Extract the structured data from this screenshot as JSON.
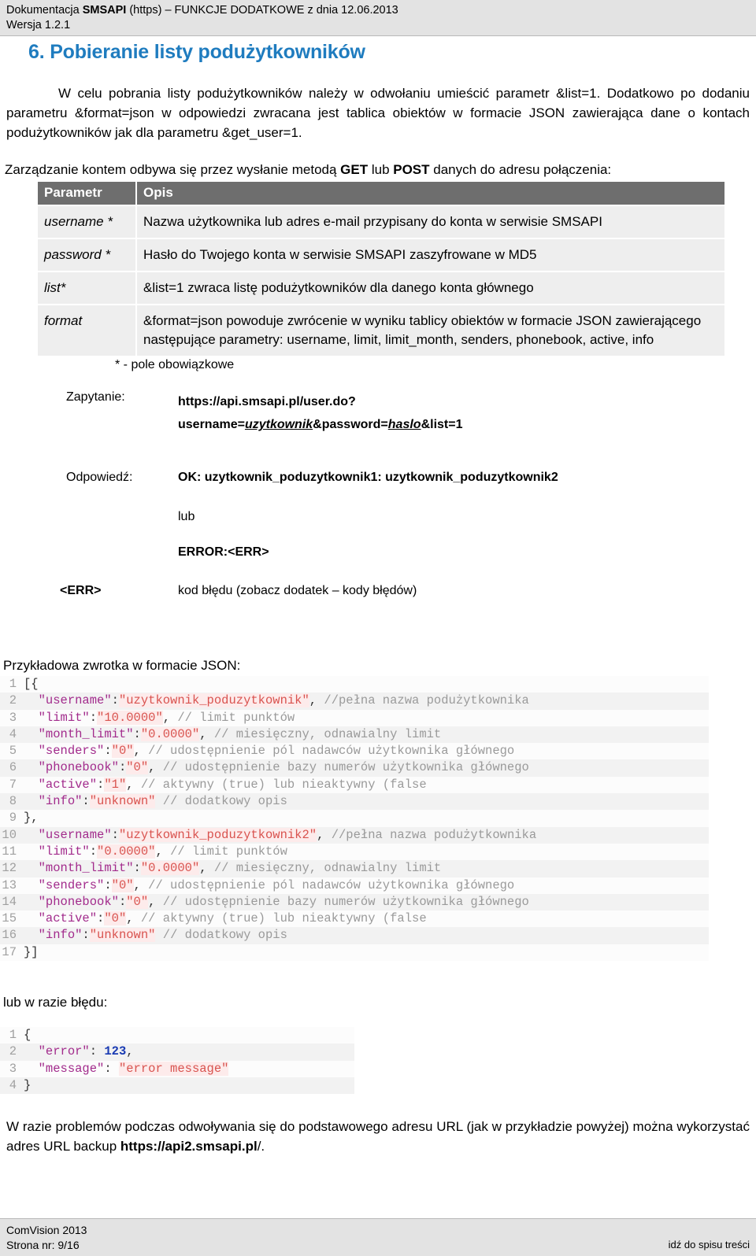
{
  "header": {
    "line1_prefix": "Dokumentacja ",
    "line1_bold": "SMSAPI",
    "line1_suffix": " (https) – FUNKCJE DODATKOWE  z dnia 12.06.2013",
    "line2": "Wersja 1.2.1"
  },
  "section": {
    "title": "6. Pobieranie listy podużytkowników",
    "intro": "W celu pobrania listy podużytkowników należy w odwołaniu umieścić parametr &list=1. Dodatkowo po dodaniu parametru &format=json w odpowiedzi zwracana jest tablica obiektów w formacie JSON zawierająca dane o kontach podużytkowników jak dla parametru &get_user=1."
  },
  "mgmt": {
    "part1": "Zarządzanie kontem odbywa się przez wysłanie metodą ",
    "get": "GET",
    "mid": " lub ",
    "post": "POST",
    "part2": " danych do adresu połączenia:"
  },
  "table": {
    "headers": [
      "Parametr",
      "Opis"
    ],
    "rows": [
      {
        "param": "username *",
        "desc": "Nazwa użytkownika lub adres e-mail przypisany do konta  w serwisie SMSAPI"
      },
      {
        "param": "password *",
        "desc": "Hasło do Twojego konta w serwisie SMSAPI zaszyfrowane w MD5"
      },
      {
        "param": "list*",
        "desc": "&list=1 zwraca listę podużytkowników dla danego konta głównego"
      },
      {
        "param": "format",
        "desc": "&format=json powoduje zwrócenie w wyniku tablicy obiektów w formacie JSON zawierającego następujące parametry: username, limit, limit_month, senders, phonebook, active, info"
      }
    ],
    "required_note": "* - pole obowiązkowe"
  },
  "query": {
    "label": "Zapytanie:",
    "url_line1": "https://api.smsapi.pl/user.do?",
    "url_line2_a": "username=",
    "url_line2_b": "uzytkownik",
    "url_line2_c": "&password=",
    "url_line2_d": "haslo",
    "url_line2_e": "&list=1"
  },
  "response": {
    "label": "Odpowiedź:",
    "ok": "OK: uzytkownik_poduzytkownik1: uzytkownik_poduzytkownik2",
    "or": "lub",
    "error": "ERROR:<ERR>",
    "err_label": "<ERR>",
    "err_desc": "kod błędu (zobacz dodatek – kody błędów)"
  },
  "json_example": {
    "caption": "Przykładowa zwrotka w formacie JSON:",
    "lines": [
      {
        "n": "1",
        "tokens": [
          {
            "t": "pl",
            "v": "[{"
          }
        ]
      },
      {
        "n": "2",
        "tokens": [
          {
            "t": "pl",
            "v": "  "
          },
          {
            "t": "key",
            "v": "\"username\""
          },
          {
            "t": "pl",
            "v": ":"
          },
          {
            "t": "str",
            "v": "\"uzytkownik_poduzytkownik\""
          },
          {
            "t": "pl",
            "v": ", "
          },
          {
            "t": "com",
            "v": "//pełna nazwa podużytkownika"
          }
        ]
      },
      {
        "n": "3",
        "tokens": [
          {
            "t": "pl",
            "v": "  "
          },
          {
            "t": "key",
            "v": "\"limit\""
          },
          {
            "t": "pl",
            "v": ":"
          },
          {
            "t": "str",
            "v": "\"10.0000\""
          },
          {
            "t": "pl",
            "v": ", "
          },
          {
            "t": "com",
            "v": "// limit punktów"
          }
        ]
      },
      {
        "n": "4",
        "tokens": [
          {
            "t": "pl",
            "v": "  "
          },
          {
            "t": "key",
            "v": "\"month_limit\""
          },
          {
            "t": "pl",
            "v": ":"
          },
          {
            "t": "str",
            "v": "\"0.0000\""
          },
          {
            "t": "pl",
            "v": ", "
          },
          {
            "t": "com",
            "v": "// miesięczny, odnawialny limit"
          }
        ]
      },
      {
        "n": "5",
        "tokens": [
          {
            "t": "pl",
            "v": "  "
          },
          {
            "t": "key",
            "v": "\"senders\""
          },
          {
            "t": "pl",
            "v": ":"
          },
          {
            "t": "str",
            "v": "\"0\""
          },
          {
            "t": "pl",
            "v": ", "
          },
          {
            "t": "com",
            "v": "// udostępnienie pól nadawców użytkownika głównego"
          }
        ]
      },
      {
        "n": "6",
        "tokens": [
          {
            "t": "pl",
            "v": "  "
          },
          {
            "t": "key",
            "v": "\"phonebook\""
          },
          {
            "t": "pl",
            "v": ":"
          },
          {
            "t": "str",
            "v": "\"0\""
          },
          {
            "t": "pl",
            "v": ", "
          },
          {
            "t": "com",
            "v": "// udostępnienie bazy numerów użytkownika głównego"
          }
        ]
      },
      {
        "n": "7",
        "tokens": [
          {
            "t": "pl",
            "v": "  "
          },
          {
            "t": "key",
            "v": "\"active\""
          },
          {
            "t": "pl",
            "v": ":"
          },
          {
            "t": "str",
            "v": "\"1\""
          },
          {
            "t": "pl",
            "v": ", "
          },
          {
            "t": "com",
            "v": "// aktywny (true) lub nieaktywny (false"
          }
        ]
      },
      {
        "n": "8",
        "tokens": [
          {
            "t": "pl",
            "v": "  "
          },
          {
            "t": "key",
            "v": "\"info\""
          },
          {
            "t": "pl",
            "v": ":"
          },
          {
            "t": "str",
            "v": "\"unknown\""
          },
          {
            "t": "pl",
            "v": " "
          },
          {
            "t": "com",
            "v": "// dodatkowy opis"
          }
        ]
      },
      {
        "n": "9",
        "tokens": [
          {
            "t": "pl",
            "v": "},"
          }
        ]
      },
      {
        "n": "10",
        "tokens": [
          {
            "t": "pl",
            "v": "  "
          },
          {
            "t": "key",
            "v": "\"username\""
          },
          {
            "t": "pl",
            "v": ":"
          },
          {
            "t": "str",
            "v": "\"uzytkownik_poduzytkownik2\""
          },
          {
            "t": "pl",
            "v": ", "
          },
          {
            "t": "com",
            "v": "//pełna nazwa podużytkownika"
          }
        ]
      },
      {
        "n": "11",
        "tokens": [
          {
            "t": "pl",
            "v": "  "
          },
          {
            "t": "key",
            "v": "\"limit\""
          },
          {
            "t": "pl",
            "v": ":"
          },
          {
            "t": "str",
            "v": "\"0.0000\""
          },
          {
            "t": "pl",
            "v": ", "
          },
          {
            "t": "com",
            "v": "// limit punktów"
          }
        ]
      },
      {
        "n": "12",
        "tokens": [
          {
            "t": "pl",
            "v": "  "
          },
          {
            "t": "key",
            "v": "\"month_limit\""
          },
          {
            "t": "pl",
            "v": ":"
          },
          {
            "t": "str",
            "v": "\"0.0000\""
          },
          {
            "t": "pl",
            "v": ", "
          },
          {
            "t": "com",
            "v": "// miesięczny, odnawialny limit"
          }
        ]
      },
      {
        "n": "13",
        "tokens": [
          {
            "t": "pl",
            "v": "  "
          },
          {
            "t": "key",
            "v": "\"senders\""
          },
          {
            "t": "pl",
            "v": ":"
          },
          {
            "t": "str",
            "v": "\"0\""
          },
          {
            "t": "pl",
            "v": ", "
          },
          {
            "t": "com",
            "v": "// udostępnienie pól nadawców użytkownika głównego"
          }
        ]
      },
      {
        "n": "14",
        "tokens": [
          {
            "t": "pl",
            "v": "  "
          },
          {
            "t": "key",
            "v": "\"phonebook\""
          },
          {
            "t": "pl",
            "v": ":"
          },
          {
            "t": "str",
            "v": "\"0\""
          },
          {
            "t": "pl",
            "v": ", "
          },
          {
            "t": "com",
            "v": "// udostępnienie bazy numerów użytkownika głównego"
          }
        ]
      },
      {
        "n": "15",
        "tokens": [
          {
            "t": "pl",
            "v": "  "
          },
          {
            "t": "key",
            "v": "\"active\""
          },
          {
            "t": "pl",
            "v": ":"
          },
          {
            "t": "str",
            "v": "\"0\""
          },
          {
            "t": "pl",
            "v": ", "
          },
          {
            "t": "com",
            "v": "// aktywny (true) lub nieaktywny (false"
          }
        ]
      },
      {
        "n": "16",
        "tokens": [
          {
            "t": "pl",
            "v": "  "
          },
          {
            "t": "key",
            "v": "\"info\""
          },
          {
            "t": "pl",
            "v": ":"
          },
          {
            "t": "str",
            "v": "\"unknown\""
          },
          {
            "t": "pl",
            "v": " "
          },
          {
            "t": "com",
            "v": "// dodatkowy opis"
          }
        ]
      },
      {
        "n": "17",
        "tokens": [
          {
            "t": "pl",
            "v": "}]"
          }
        ]
      }
    ]
  },
  "error_example": {
    "caption": "lub w razie błędu:",
    "lines": [
      {
        "n": "1",
        "tokens": [
          {
            "t": "pl",
            "v": "{"
          }
        ]
      },
      {
        "n": "2",
        "tokens": [
          {
            "t": "pl",
            "v": "  "
          },
          {
            "t": "key",
            "v": "\"error\""
          },
          {
            "t": "pl",
            "v": ": "
          },
          {
            "t": "num",
            "v": "123"
          },
          {
            "t": "pl",
            "v": ","
          }
        ]
      },
      {
        "n": "3",
        "tokens": [
          {
            "t": "pl",
            "v": "  "
          },
          {
            "t": "key",
            "v": "\"message\""
          },
          {
            "t": "pl",
            "v": ": "
          },
          {
            "t": "str",
            "v": "\"error message\""
          }
        ]
      },
      {
        "n": "4",
        "tokens": [
          {
            "t": "pl",
            "v": "}"
          }
        ]
      }
    ]
  },
  "closing": {
    "text_a": "W razie problemów podczas odwoływania się do podstawowego adresu URL (jak w przykładzie powyżej) można wykorzystać adres URL backup ",
    "url": "https://api2.smsapi.pl",
    "text_b": "/."
  },
  "footer": {
    "company": "ComVision 2013",
    "page": "Strona nr: 9/16",
    "toc_link": "idź do spisu treści"
  },
  "colors": {
    "heading_blue": "#1f7cbf",
    "table_header_bg": "#6e6e6e",
    "table_row_bg": "#eeeeee",
    "band_bg": "#e3e3e3",
    "code_string": "#d9534f",
    "code_key": "#a22b8c",
    "code_comment": "#9a9a9a",
    "code_number": "#1a3bb3"
  }
}
